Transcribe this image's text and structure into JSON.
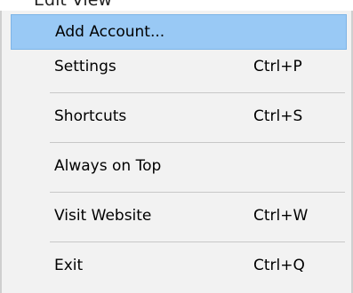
{
  "top_strip_text": "Edit View",
  "menu": {
    "items": [
      {
        "label": "Add Account...",
        "shortcut": ""
      },
      {
        "label": "Settings",
        "shortcut": "Ctrl+P"
      },
      {
        "label": "Shortcuts",
        "shortcut": "Ctrl+S"
      },
      {
        "label": "Always on Top",
        "shortcut": ""
      },
      {
        "label": "Visit Website",
        "shortcut": "Ctrl+W"
      },
      {
        "label": "Exit",
        "shortcut": "Ctrl+Q"
      }
    ]
  },
  "colors": {
    "menu_background": "#f2f2f2",
    "highlight": "#99c9f5",
    "highlight_border": "#7db4e6",
    "separator": "#c8c8c8",
    "text": "#000000"
  }
}
